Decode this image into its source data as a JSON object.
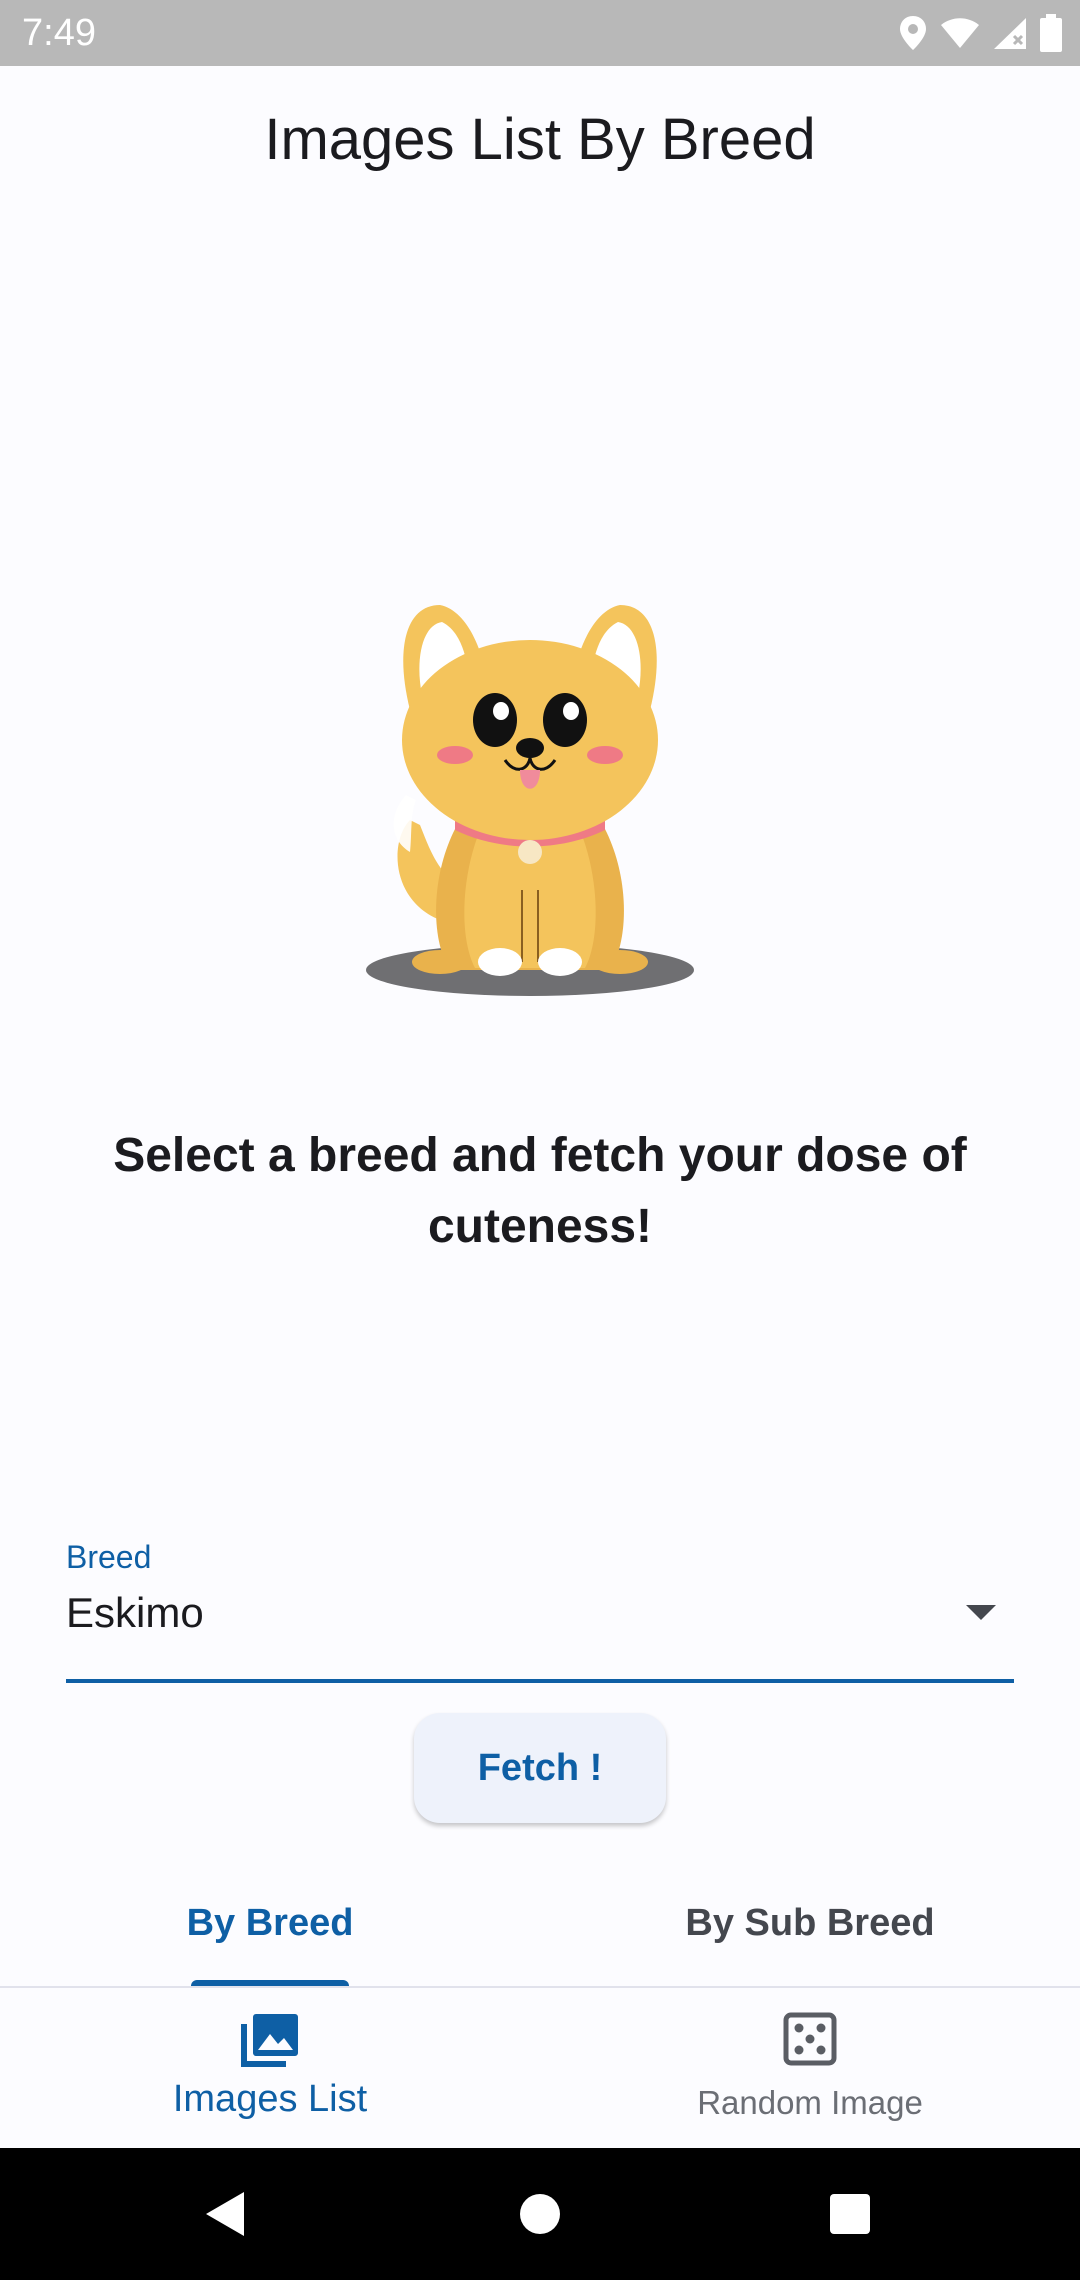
{
  "status_bar": {
    "time": "7:49",
    "icons": [
      "location-icon",
      "wifi-icon",
      "signal-icon",
      "battery-icon"
    ]
  },
  "app_bar": {
    "title": "Images List By Breed"
  },
  "illustration": {
    "icon": "cartoon-dog-illustration"
  },
  "main": {
    "headline": "Select a breed and fetch your dose of cuteness!"
  },
  "breed_dropdown": {
    "label": "Breed",
    "value": "Eskimo"
  },
  "fetch_button": {
    "label": "Fetch !"
  },
  "tabs": [
    {
      "label": "By Breed",
      "selected": true
    },
    {
      "label": "By Sub Breed",
      "selected": false
    }
  ],
  "bottom_nav": [
    {
      "label": "Images List",
      "icon": "photo-library-icon",
      "selected": true
    },
    {
      "label": "Random Image",
      "icon": "dice-icon",
      "selected": false
    }
  ],
  "colors": {
    "primary": "#0e5fa5",
    "background": "#fcfcff",
    "status_bar": "#b8b8b8",
    "dog_body": "#f4c45c",
    "collar": "#ef7a85"
  }
}
